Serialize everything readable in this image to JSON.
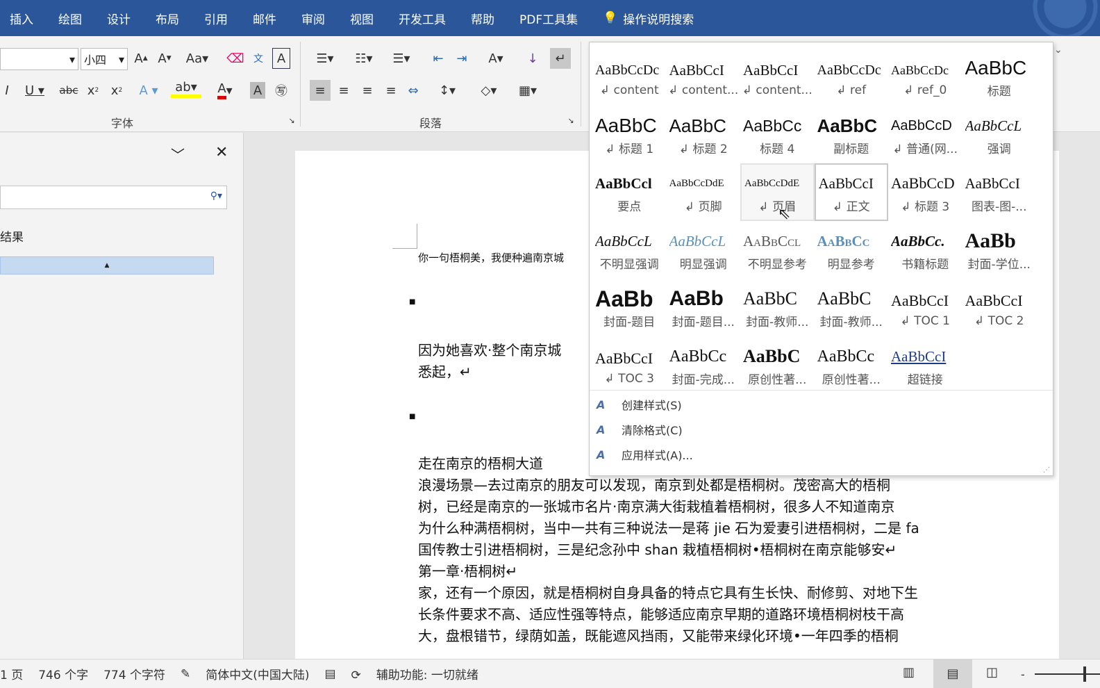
{
  "tabs": [
    "插入",
    "绘图",
    "设计",
    "布局",
    "引用",
    "邮件",
    "审阅",
    "视图",
    "开发工具",
    "帮助",
    "PDF工具集"
  ],
  "tell_me": "操作说明搜索",
  "ribbon": {
    "font_size": "小四",
    "font_group": "字体",
    "para_group": "段落"
  },
  "nav": {
    "results_label": "结果"
  },
  "doc": {
    "header_line": "你一句梧桐美，我便种遍南京城",
    "p1": "因为她喜欢·整个南京城",
    "p1b": "悉起，↵",
    "lines": [
      "走在南京的梧桐大道",
      "浪漫场景—去过南京的朋友可以发现，南京到处都是梧桐树。茂密高大的梧桐",
      "树，已经是南京的一张城市名片·南京满大街栽植着梧桐树，很多人不知道南京",
      "为什么种满梧桐树，当中一共有三种说法一是蒋 jie 石为爱妻引进梧桐树，二是 fa",
      "国传教士引进梧桐树，三是纪念孙中 shan 栽植梧桐树•梧桐树在南京能够安↵",
      "第一章·梧桐树↵",
      "家，还有一个原因，就是梧桐树自身具备的特点它具有生长快、耐修剪、对地下生",
      "长条件要求不高、适应性强等特点，能够适应南京早期的道路环境梧桐树枝干高",
      "大，盘根错节，绿荫如盖，既能遮风挡雨，又能带来绿化环境•一年四季的梧桐"
    ]
  },
  "styles": [
    {
      "preview": "AaBbCcDc",
      "name": "↲ content"
    },
    {
      "preview": "AaBbCcI",
      "name": "↲ content..."
    },
    {
      "preview": "AaBbCcI",
      "name": "↲ content..."
    },
    {
      "preview": "AaBbCcDc",
      "name": "↲ ref"
    },
    {
      "preview": "AaBbCcDc",
      "name": "↲ ref_0"
    },
    {
      "preview": "AaBbC",
      "name": "标题"
    },
    {
      "preview": "AaBbC",
      "name": "↲ 标题 1"
    },
    {
      "preview": "AaBbC",
      "name": "↲ 标题 2"
    },
    {
      "preview": "AaBbCc",
      "name": "标题 4"
    },
    {
      "preview": "AaBbC",
      "name": "副标题"
    },
    {
      "preview": "AaBbCcD",
      "name": "↲ 普通(网..."
    },
    {
      "preview": "AaBbCcL",
      "name": "强调"
    },
    {
      "preview": "AaBbCcl",
      "name": "要点"
    },
    {
      "preview": "AaBbCcDdE",
      "name": "↲ 页脚"
    },
    {
      "preview": "AaBbCcDdE",
      "name": "↲ 页眉"
    },
    {
      "preview": "AaBbCcI",
      "name": "↲ 正文"
    },
    {
      "preview": "AaBbCcD",
      "name": "↲ 标题 3"
    },
    {
      "preview": "AaBbCcI",
      "name": "图表-图-..."
    },
    {
      "preview": "AaBbCcL",
      "name": "不明显强调"
    },
    {
      "preview": "AaBbCcL",
      "name": "明显强调"
    },
    {
      "preview": "AaBbCcl",
      "name": "不明显参考"
    },
    {
      "preview": "AaBbCc",
      "name": "明显参考"
    },
    {
      "preview": "AaBbCc.",
      "name": "书籍标题"
    },
    {
      "preview": "AaBb",
      "name": "封面-学位..."
    },
    {
      "preview": "AaBb",
      "name": "封面-题目"
    },
    {
      "preview": "AaBb",
      "name": "封面-题目..."
    },
    {
      "preview": "AaBbC",
      "name": "封面-教师..."
    },
    {
      "preview": "AaBbC",
      "name": "封面-教师..."
    },
    {
      "preview": "AaBbCcI",
      "name": "↲ TOC 1"
    },
    {
      "preview": "AaBbCcI",
      "name": "↲ TOC 2"
    },
    {
      "preview": "AaBbCcI",
      "name": "↲ TOC 3"
    },
    {
      "preview": "AaBbCc",
      "name": "封面-完成..."
    },
    {
      "preview": "AaBbC",
      "name": "原创性著..."
    },
    {
      "preview": "AaBbCc",
      "name": "原创性著..."
    },
    {
      "preview": "AaBbCcI",
      "name": "超链接"
    }
  ],
  "style_menu": [
    {
      "icon": "create-style-icon",
      "label": "创建样式(S)"
    },
    {
      "icon": "clear-format-icon",
      "label": "清除格式(C)"
    },
    {
      "icon": "apply-style-icon",
      "label": "应用样式(A)..."
    }
  ],
  "status": {
    "page": "1 页",
    "words": "746 个字",
    "chars": "774 个字符",
    "language": "简体中文(中国大陆)",
    "accessibility": "辅助功能: 一切就绪"
  },
  "colors": {
    "brand": "#2b579a",
    "highlight": "#ffff00",
    "font_color": "#e00000",
    "nav_selected": "#c5d9f1"
  }
}
